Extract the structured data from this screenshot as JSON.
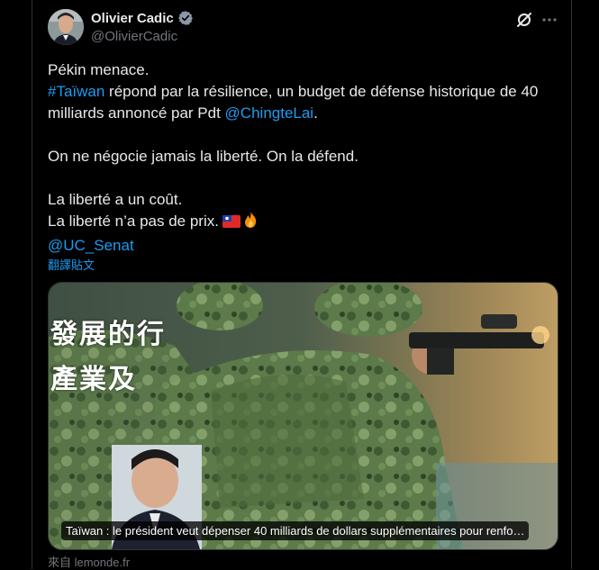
{
  "author": {
    "display_name": "Olivier Cadic",
    "handle": "@OlivierCadic",
    "verified_icon": "verified-badge-icon"
  },
  "actions": {
    "grok_icon": "grok-icon",
    "more_icon": "more-options-icon"
  },
  "tweet": {
    "line1": "Pékin menace.",
    "hashtag": "#Taïwan",
    "line2_rest": " répond par la résilience, un budget de défense historique de 40 milliards annoncé par Pdt ",
    "mention1": "@ChingteLai",
    "line2_end": ".",
    "line3": "On ne négocie jamais la liberté. On la défend.",
    "line4": "La liberté a un coût.",
    "line5": "La liberté n’a pas de prix.",
    "emojis": [
      "taiwan-flag-icon",
      "fire-icon"
    ],
    "mention2": "@UC_Senat"
  },
  "translate_label": "翻譯貼文",
  "card": {
    "overlay_line1": "發展的行",
    "overlay_line2": "產業及",
    "caption": "Taïwan : le président veut dépenser 40 milliards de dollars supplémentaires pour renfo…"
  },
  "source_label": "來自 lemonde.fr",
  "colors": {
    "accent": "#1d9bf0",
    "text": "#e7e9ea",
    "muted": "#71767b",
    "background": "#000000"
  }
}
